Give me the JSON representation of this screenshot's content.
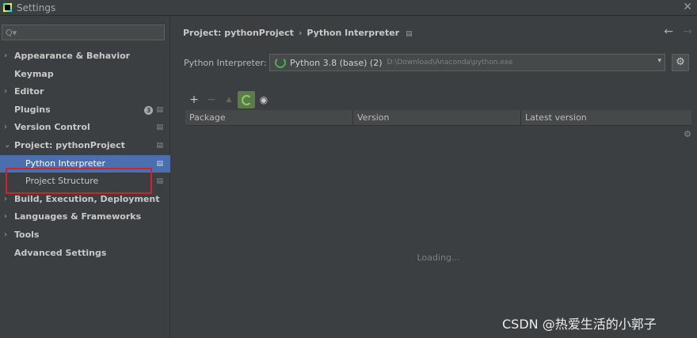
{
  "window": {
    "title": "Settings",
    "close_glyph": "✕",
    "logo_icon": "pycharm-logo"
  },
  "search": {
    "value": "",
    "placeholder": "",
    "glyph": "Q▾"
  },
  "sidebar": {
    "items": [
      {
        "label": "Appearance & Behavior",
        "arrow": "›",
        "badge": ""
      },
      {
        "label": "Keymap",
        "arrow": "",
        "badge": ""
      },
      {
        "label": "Editor",
        "arrow": "›",
        "badge": ""
      },
      {
        "label": "Plugins",
        "arrow": "",
        "badge": "▤",
        "count": "3"
      },
      {
        "label": "Version Control",
        "arrow": "›",
        "badge": "▤"
      },
      {
        "label": "Project: pythonProject",
        "arrow": "⌄",
        "badge": "▤"
      },
      {
        "label": "Python Interpreter",
        "arrow": "",
        "badge": "▤",
        "selected": true
      },
      {
        "label": "Project Structure",
        "arrow": "",
        "badge": "▤"
      },
      {
        "label": "Build, Execution, Deployment",
        "arrow": "›",
        "badge": ""
      },
      {
        "label": "Languages & Frameworks",
        "arrow": "›",
        "badge": ""
      },
      {
        "label": "Tools",
        "arrow": "›",
        "badge": ""
      },
      {
        "label": "Advanced Settings",
        "arrow": "",
        "badge": ""
      }
    ]
  },
  "breadcrumb": {
    "project": "Project: pythonProject",
    "separator": "›",
    "page": "Python Interpreter",
    "pin": "▤"
  },
  "nav": {
    "back": "←",
    "forward": "→"
  },
  "interpreter": {
    "label": "Python Interpreter:",
    "name": "Python 3.8 (base) (2)",
    "path": "D:\\Download\\Anaconda\\python.exe",
    "caret": "▾",
    "gear": "⚙"
  },
  "toolbar": {
    "add": "+",
    "remove": "−",
    "up": "▲",
    "eye": "👁"
  },
  "table": {
    "columns": [
      "Package",
      "Version",
      "Latest version"
    ],
    "loading": "Loading...",
    "gear": "⚙"
  },
  "watermark": "CSDN @热爱生活的小郭子",
  "colors": {
    "accent": "#4b6eaf",
    "highlight_box": "#d2232a",
    "spinner": "#4cae4c"
  }
}
